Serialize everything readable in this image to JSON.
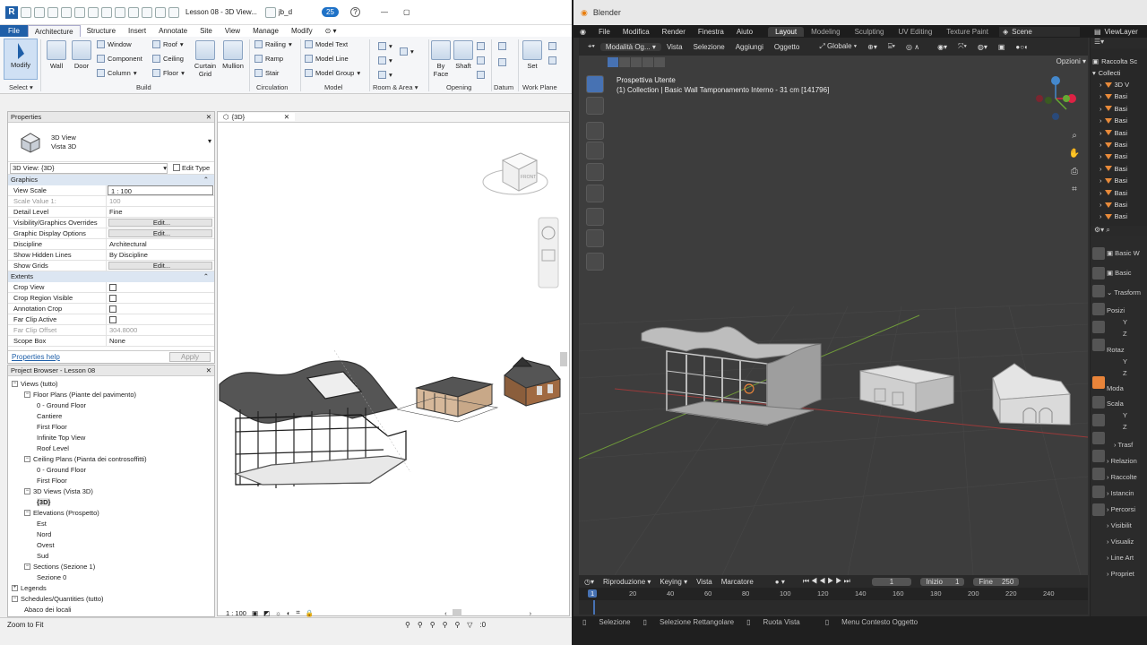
{
  "revit": {
    "title": "Lesson 08 - 3D View...",
    "user": "jb_d",
    "badge_count": "25",
    "tabs": [
      "File",
      "Architecture",
      "Structure",
      "Insert",
      "Annotate",
      "Site",
      "View",
      "Manage",
      "Modify"
    ],
    "ribbon": {
      "modify": "Modify",
      "select": "Select",
      "wall": "Wall",
      "door": "Door",
      "window": "Window",
      "component": "Component",
      "column": "Column",
      "roof": "Roof",
      "ceiling": "Ceiling",
      "floor": "Floor",
      "curtain_grid": "Curtain Grid",
      "mullion": "Mullion",
      "railing": "Railing",
      "ramp": "Ramp",
      "stair": "Stair",
      "model_text": "Model Text",
      "model_line": "Model Line",
      "model_group": "Model Group",
      "by_face": "By Face",
      "shaft": "Shaft",
      "set": "Set",
      "groups": [
        "Build",
        "Circulation",
        "Model",
        "Room & Area",
        "Opening",
        "Datum",
        "Work Plane"
      ]
    },
    "properties": {
      "title": "Properties",
      "type_line1": "3D View",
      "type_line2": "Vista 3D",
      "selector": "3D View: {3D}",
      "edit_type": "Edit Type",
      "group_graphics": "Graphics",
      "rows_graphics": [
        {
          "k": "View Scale",
          "v": "1 : 100"
        },
        {
          "k": "Scale Value    1:",
          "v": "100"
        },
        {
          "k": "Detail Level",
          "v": "Fine"
        },
        {
          "k": "Visibility/Graphics Overrides",
          "v": "Edit..."
        },
        {
          "k": "Graphic Display Options",
          "v": "Edit..."
        },
        {
          "k": "Discipline",
          "v": "Architectural"
        },
        {
          "k": "Show Hidden Lines",
          "v": "By Discipline"
        },
        {
          "k": "Show Grids",
          "v": "Edit..."
        }
      ],
      "group_extents": "Extents",
      "rows_extents": [
        {
          "k": "Crop View",
          "v": ""
        },
        {
          "k": "Crop Region Visible",
          "v": ""
        },
        {
          "k": "Annotation Crop",
          "v": ""
        },
        {
          "k": "Far Clip Active",
          "v": ""
        },
        {
          "k": "Far Clip Offset",
          "v": "304.8000"
        },
        {
          "k": "Scope Box",
          "v": "None"
        }
      ],
      "help": "Properties help",
      "apply": "Apply"
    },
    "browser": {
      "title": "Project Browser - Lesson 08",
      "items": [
        "Views (tutto)",
        "Floor Plans (Piante del pavimento)",
        "0 - Ground Floor",
        "Cantiere",
        "First Floor",
        "Infinite Top View",
        "Roof Level",
        "Ceiling Plans (Pianta dei controsoffitti)",
        "0 - Ground Floor",
        "First Floor",
        "3D Views (Vista 3D)",
        "{3D}",
        "Elevations (Prospetto)",
        "Est",
        "Nord",
        "Ovest",
        "Sud",
        "Sections (Sezione 1)",
        "Sezione 0",
        "Legends",
        "Schedules/Quantities (tutto)",
        "Abaco dei locali"
      ]
    },
    "view_tab": "{3D}",
    "viewcube_label": "FRONT",
    "view_scale": "1 : 100",
    "status": "Zoom to Fit",
    "filter_count": ":0"
  },
  "blender": {
    "title": "Blender",
    "menu": [
      "File",
      "Modifica",
      "Render",
      "Finestra",
      "Aiuto"
    ],
    "workspaces": [
      "Layout",
      "Modeling",
      "Sculpting",
      "UV Editing",
      "Texture Paint"
    ],
    "scene": "Scene",
    "viewlayer": "ViewLayer",
    "vp_menu": [
      "Modalità Og...",
      "Vista",
      "Selezione",
      "Aggiungi",
      "Oggetto"
    ],
    "orientation": "Globale",
    "options": "Opzioni",
    "vp_title": "Prospettiva Utente",
    "vp_subtitle": "(1) Collection | Basic Wall Tamponamento Interno - 31 cm [141796]",
    "timeline_menu": [
      "Riproduzione",
      "Keying",
      "Vista",
      "Marcatore"
    ],
    "current_frame": "1",
    "start_label": "Inizio",
    "start": "1",
    "end_label": "Fine",
    "end": "250",
    "ruler": [
      "1",
      "20",
      "40",
      "60",
      "80",
      "100",
      "120",
      "140",
      "160",
      "180",
      "200",
      "220",
      "240"
    ],
    "status": [
      "Selezione",
      "Selezione Rettangolare",
      "Ruota Vista",
      "Menu Contesto Oggetto"
    ],
    "outliner": {
      "scene_collection": "Raccolta Sc",
      "collection": "Collecti",
      "items": [
        "3D V",
        "Basi",
        "Basi",
        "Basi",
        "Basi",
        "Basi",
        "Basi",
        "Basi",
        "Basi",
        "Basi",
        "Basi",
        "Basi"
      ]
    },
    "props_panel": {
      "object": "Basic W",
      "data": "Basic",
      "transform": "Trasform",
      "location": "Posizi",
      "rotation": "Rotaz",
      "mode": "Moda",
      "scale": "Scala",
      "axis_y": "Y",
      "axis_z": "Z",
      "delta": "Trasf",
      "sections": [
        "Relazion",
        "Raccolte",
        "Istancin",
        "Percorsi",
        "Visibilit",
        "Visualiz",
        "Line Art",
        "Propriet"
      ]
    }
  }
}
